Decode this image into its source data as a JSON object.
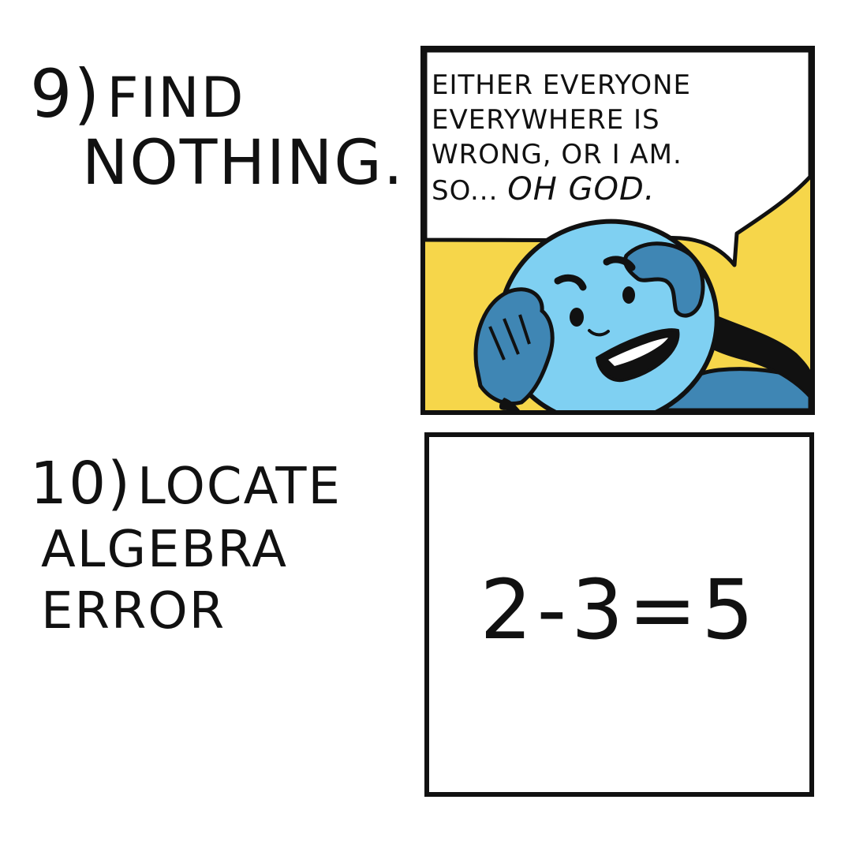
{
  "step9": {
    "number": "9)",
    "line1": "FIND",
    "line2": "NOTHING."
  },
  "panel_top": {
    "bubble_lines": [
      "EITHER EVERYONE",
      "EVERYWHERE IS",
      "WRONG, OR I AM.",
      "SO..."
    ],
    "bubble_emphasis": "OH GOD."
  },
  "step10": {
    "number": "10)",
    "line1": "LOCATE",
    "line2": "ALGEBRA",
    "line3": "ERROR"
  },
  "panel_bottom": {
    "equation": "2-3=5"
  },
  "colors": {
    "panel_yellow": "#f6d64a",
    "character_blue": "#7fd0f2",
    "shirt_blue": "#3f86b4",
    "ink": "#111111"
  },
  "icons": {
    "character": "distressed-character-icon"
  }
}
